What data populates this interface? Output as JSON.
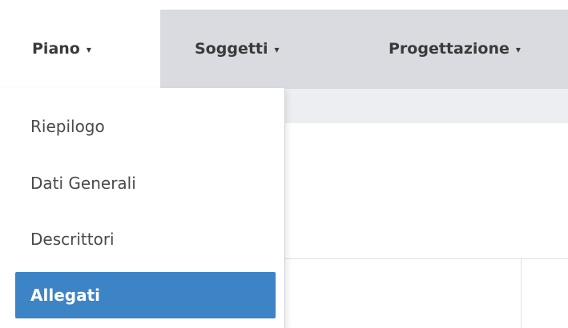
{
  "nav": {
    "items": [
      {
        "label": "Piano",
        "caret": "▾"
      },
      {
        "label": "Soggetti",
        "caret": "▾"
      },
      {
        "label": "Progettazione",
        "caret": "▾"
      }
    ]
  },
  "dropdown": {
    "items": [
      {
        "label": "Riepilogo"
      },
      {
        "label": "Dati Generali"
      },
      {
        "label": "Descrittori"
      },
      {
        "label": "Allegati"
      }
    ],
    "active_index": 3
  },
  "colors": {
    "navbar_bg": "#d9dbe0",
    "active_item_bg": "#3d84c6",
    "active_item_text": "#ffffff"
  }
}
